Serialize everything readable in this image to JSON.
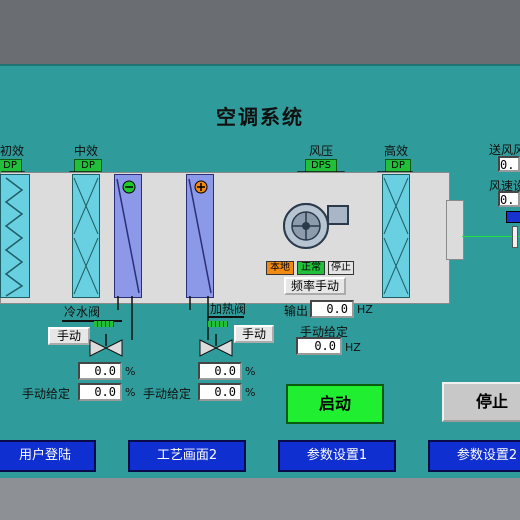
{
  "title": "空调系统",
  "sections": {
    "primary_filter": {
      "label": "初效",
      "tag": "DP"
    },
    "medium_filter": {
      "label": "中效",
      "tag": "DP"
    },
    "fan_pressure": {
      "label": "风压",
      "tag": "DPS"
    },
    "hepa_filter": {
      "label": "高效",
      "tag": "DP"
    }
  },
  "right_panel": {
    "supply_air_label": "送风风",
    "supply_air_value": "0.",
    "air_speed_label": "风速设",
    "air_speed_value": "0."
  },
  "fan": {
    "local": "本地",
    "normal": "正常",
    "stop": "停止",
    "freq_manual": "频率手动",
    "output_label": "输出",
    "output_value": "0.0",
    "output_unit": "HZ",
    "manual_set_label": "手动给定",
    "manual_set_value": "0.0",
    "manual_set_unit": "HZ"
  },
  "cold_valve": {
    "label": "冷水阀",
    "manual_btn": "手动",
    "value": "0.0",
    "unit": "%",
    "manual_set_label": "手动给定",
    "manual_set_value": "0.0",
    "manual_set_unit": "%"
  },
  "heat_valve": {
    "label": "加热阀",
    "manual_btn": "手动",
    "value": "0.0",
    "unit": "%",
    "manual_set_label": "手动给定",
    "manual_set_value": "0.0",
    "manual_set_unit": "%"
  },
  "controls": {
    "start": "启动",
    "stop": "停止"
  },
  "nav": [
    "用户登陆",
    "工艺画面2",
    "参数设置1",
    "参数设置2"
  ],
  "colors": {
    "panel_bg": "#2f9b9a",
    "start_green": "#20ee30",
    "nav_blue": "#0f2fd0",
    "filter_cyan": "#68d0e0",
    "coil_blue": "#8c98e8"
  }
}
